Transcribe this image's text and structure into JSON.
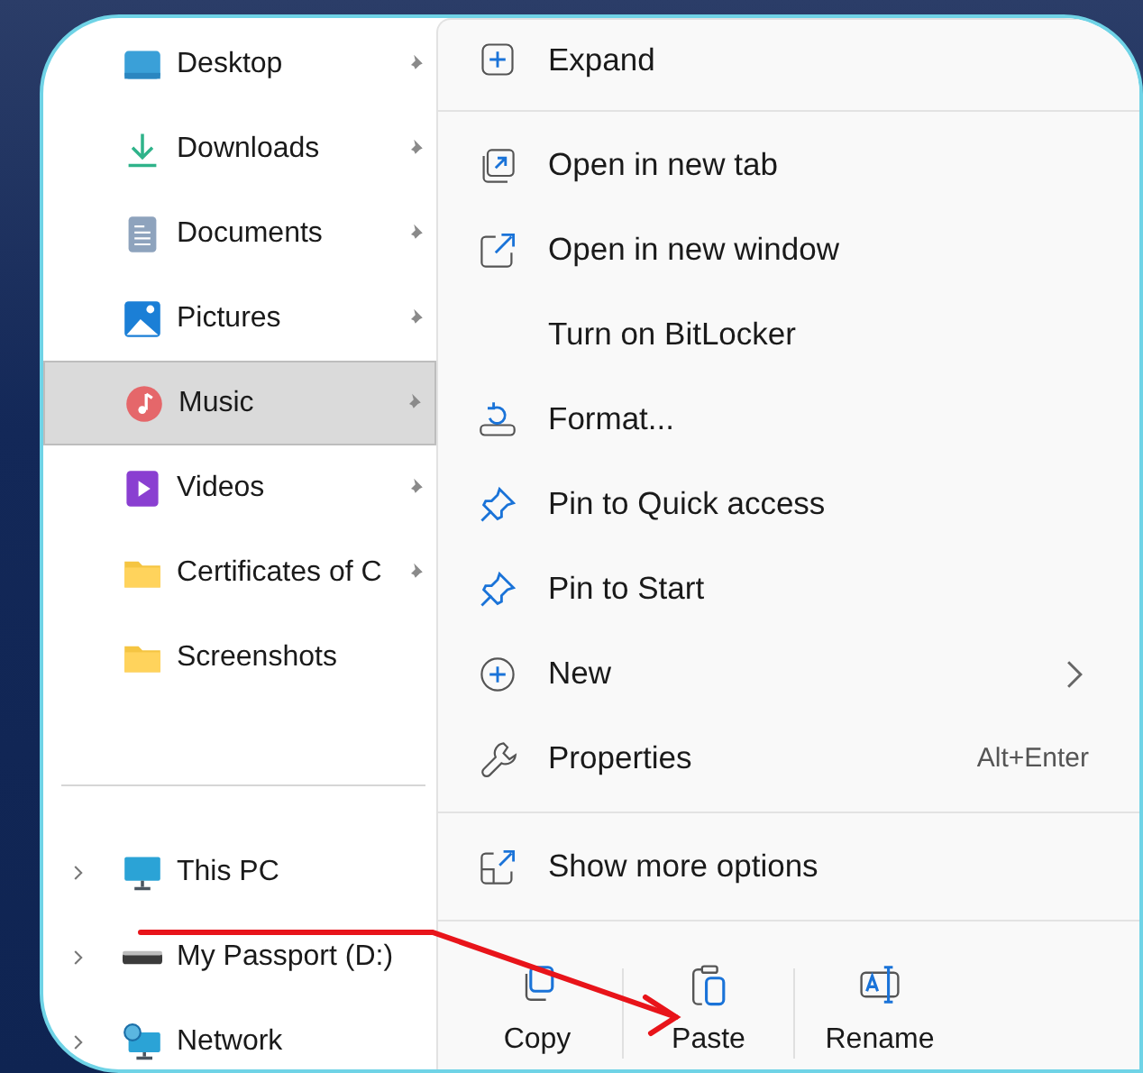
{
  "sidebar": {
    "quick_access": [
      {
        "label": "Desktop",
        "pinned": true,
        "selected": false
      },
      {
        "label": "Downloads",
        "pinned": true,
        "selected": false
      },
      {
        "label": "Documents",
        "pinned": true,
        "selected": false
      },
      {
        "label": "Pictures",
        "pinned": true,
        "selected": false
      },
      {
        "label": "Music",
        "pinned": true,
        "selected": true
      },
      {
        "label": "Videos",
        "pinned": true,
        "selected": false
      },
      {
        "label": "Certificates of C",
        "pinned": true,
        "selected": false
      },
      {
        "label": "Screenshots",
        "pinned": false,
        "selected": false
      }
    ],
    "locations": [
      {
        "label": "This PC",
        "expanded": false
      },
      {
        "label": "My Passport (D:)",
        "expanded": false
      },
      {
        "label": "Network",
        "expanded": false
      }
    ]
  },
  "context_menu": {
    "sections": [
      [
        {
          "label": "Expand"
        }
      ],
      [
        {
          "label": "Open in new tab"
        },
        {
          "label": "Open in new window"
        },
        {
          "label": "Turn on BitLocker"
        },
        {
          "label": "Format..."
        },
        {
          "label": "Pin to Quick access"
        },
        {
          "label": "Pin to Start"
        },
        {
          "label": "New",
          "submenu": true
        },
        {
          "label": "Properties",
          "shortcut": "Alt+Enter"
        }
      ],
      [
        {
          "label": "Show more options"
        }
      ]
    ],
    "actions": [
      {
        "label": "Copy"
      },
      {
        "label": "Paste"
      },
      {
        "label": "Rename"
      }
    ]
  }
}
